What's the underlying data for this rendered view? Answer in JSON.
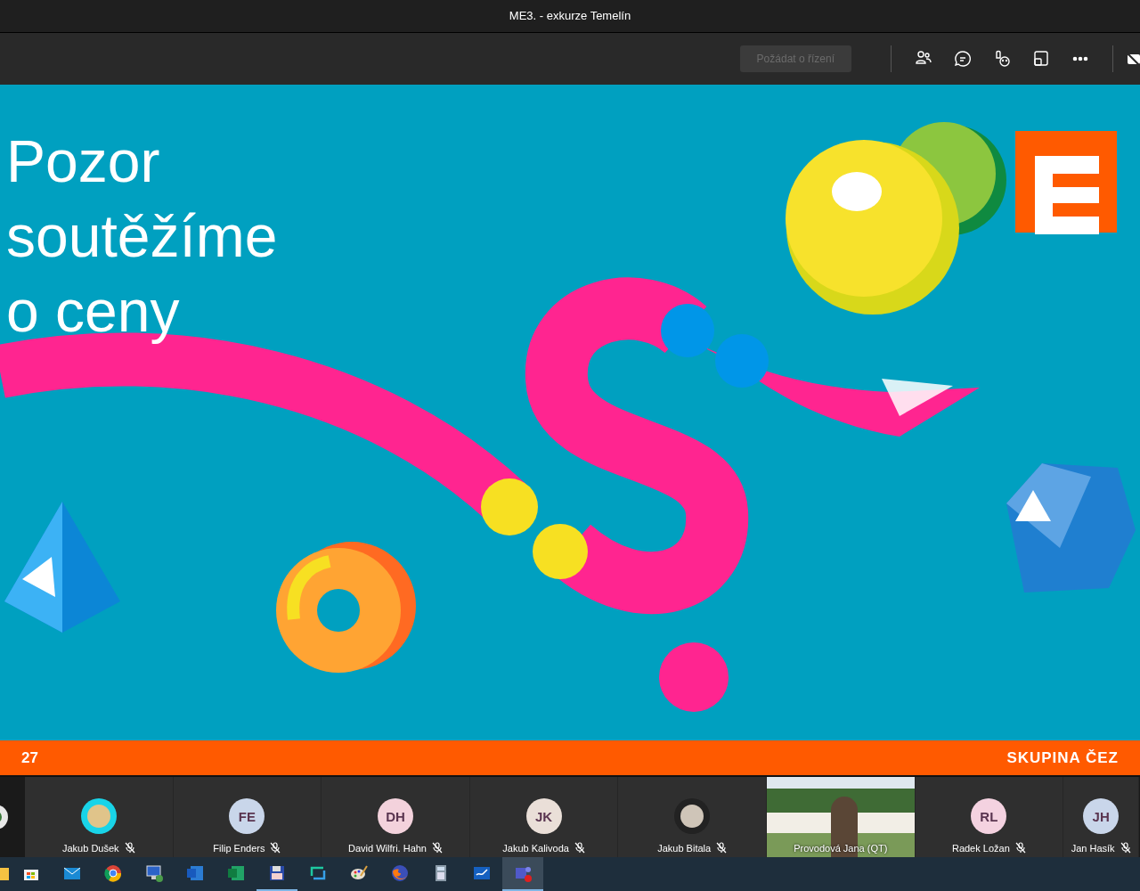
{
  "window": {
    "title": "ME3. - exkurze Temelín"
  },
  "toolbar": {
    "control_button": {
      "label": "Požádat o řízení",
      "disabled": true
    }
  },
  "slide": {
    "title_lines": [
      "Pozor",
      "soutěžíme",
      "o ceny"
    ],
    "page_number": "27",
    "brand": "SKUPINA ČEZ"
  },
  "participants": [
    {
      "name": "Jakub Dušek",
      "kind": "image",
      "muted": true
    },
    {
      "name": "Filip Enders",
      "kind": "initials",
      "initials": "FE",
      "color": "#c9d6ea",
      "muted": true
    },
    {
      "name": "David Wilfri. Hahn",
      "kind": "initials",
      "initials": "DH",
      "color": "#f3d2dc",
      "muted": true
    },
    {
      "name": "Jakub Kalivoda",
      "kind": "initials",
      "initials": "JK",
      "color": "#eadfd8",
      "muted": true
    },
    {
      "name": "Jakub Bitala",
      "kind": "image",
      "muted": true
    },
    {
      "name": "Provodová Jana (QT)",
      "kind": "video",
      "muted": false
    },
    {
      "name": "Radek Ložan",
      "kind": "initials",
      "initials": "RL",
      "color": "#f4d2e0",
      "muted": true
    },
    {
      "name": "Jan Hasík",
      "kind": "initials",
      "initials": "JH",
      "color": "#c9d6ea",
      "muted": true
    }
  ],
  "taskbar": [
    {
      "kind": "store",
      "running": false,
      "selected": false
    },
    {
      "kind": "mail",
      "running": false,
      "selected": false
    },
    {
      "kind": "browser",
      "running": false,
      "selected": false
    },
    {
      "kind": "monitor",
      "running": false,
      "selected": false
    },
    {
      "kind": "word",
      "running": false,
      "selected": false
    },
    {
      "kind": "sheet",
      "running": false,
      "selected": false
    },
    {
      "kind": "floppy",
      "running": true,
      "selected": false
    },
    {
      "kind": "screen",
      "running": false,
      "selected": false
    },
    {
      "kind": "palette",
      "running": false,
      "selected": false
    },
    {
      "kind": "fox",
      "running": false,
      "selected": false
    },
    {
      "kind": "calculator",
      "running": false,
      "selected": false
    },
    {
      "kind": "board",
      "running": false,
      "selected": false
    },
    {
      "kind": "teams",
      "running": true,
      "selected": true
    }
  ]
}
